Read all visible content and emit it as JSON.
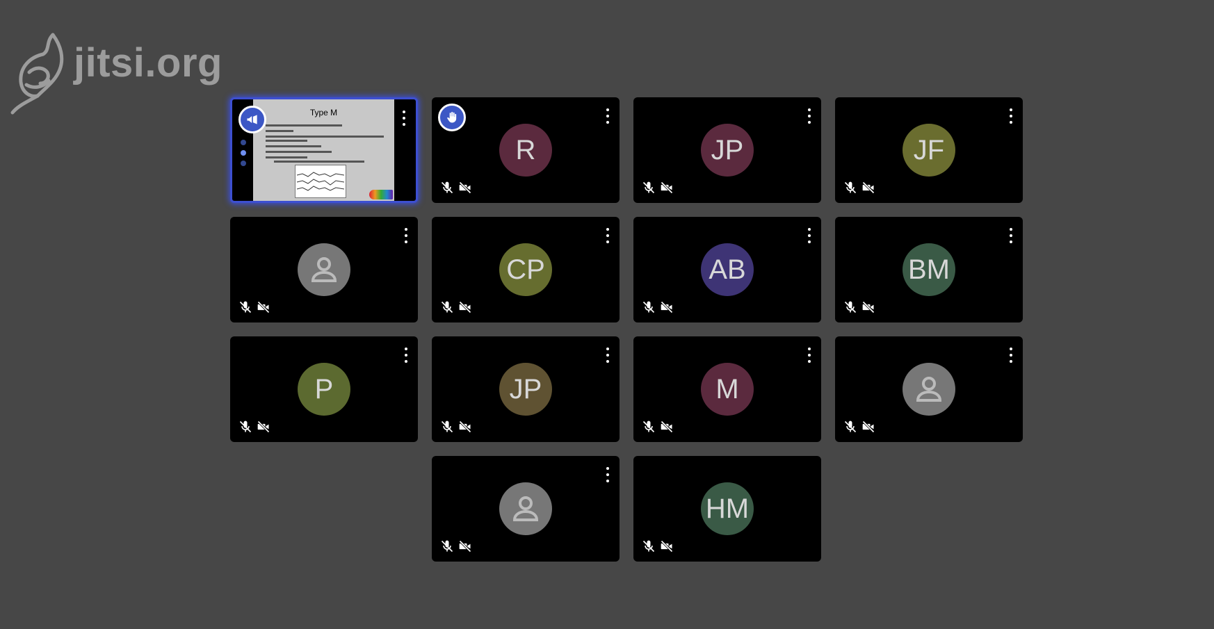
{
  "brand": {
    "logo_text": "jitsi.org"
  },
  "shared_screen": {
    "slide_title": "Type M"
  },
  "participants": [
    {
      "id": "p1",
      "initials": "",
      "avatar_color": "",
      "screen_share": true,
      "badge": "megaphone-icon",
      "mic_muted": false,
      "camera_off": false
    },
    {
      "id": "p2",
      "initials": "R",
      "avatar_color": "#5b2a3e",
      "badge": "raised-hand-icon",
      "mic_muted": true,
      "camera_off": true
    },
    {
      "id": "p3",
      "initials": "JP",
      "avatar_color": "#5b2a3e",
      "mic_muted": true,
      "camera_off": true
    },
    {
      "id": "p4",
      "initials": "JF",
      "avatar_color": "#6a6d2f",
      "mic_muted": true,
      "camera_off": true
    },
    {
      "id": "p5",
      "initials": "",
      "avatar_color": "#777777",
      "default_avatar": true,
      "mic_muted": true,
      "camera_off": true
    },
    {
      "id": "p6",
      "initials": "CP",
      "avatar_color": "#666d2f",
      "mic_muted": true,
      "camera_off": true
    },
    {
      "id": "p7",
      "initials": "AB",
      "avatar_color": "#3e3475",
      "mic_muted": true,
      "camera_off": true
    },
    {
      "id": "p8",
      "initials": "BM",
      "avatar_color": "#3a5a46",
      "mic_muted": true,
      "camera_off": true
    },
    {
      "id": "p9",
      "initials": "P",
      "avatar_color": "#5c6a30",
      "mic_muted": true,
      "camera_off": true
    },
    {
      "id": "p10",
      "initials": "JP",
      "avatar_color": "#5f5232",
      "mic_muted": true,
      "camera_off": true
    },
    {
      "id": "p11",
      "initials": "M",
      "avatar_color": "#5b2a3e",
      "mic_muted": true,
      "camera_off": true
    },
    {
      "id": "p12",
      "initials": "",
      "avatar_color": "#777777",
      "default_avatar": true,
      "mic_muted": true,
      "camera_off": true
    },
    {
      "id": "p13",
      "initials": "",
      "avatar_color": "#777777",
      "default_avatar": true,
      "mic_muted": true,
      "camera_off": true
    },
    {
      "id": "p14",
      "initials": "HM",
      "avatar_color": "#3a5a46",
      "mic_muted": true,
      "camera_off": true,
      "no_menu": true
    }
  ]
}
